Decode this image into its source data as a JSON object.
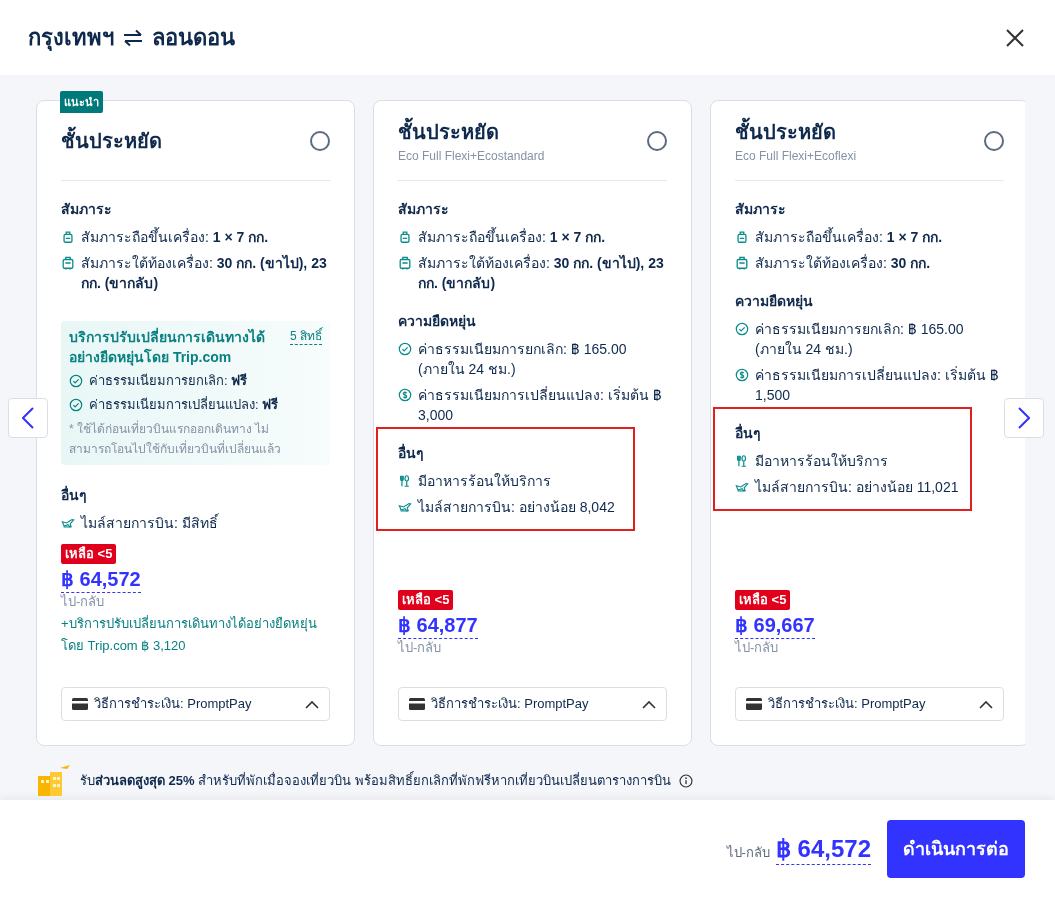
{
  "header": {
    "origin": "กรุงเทพฯ",
    "destination": "ลอนดอน"
  },
  "cards": [
    {
      "badge": "แนะนำ",
      "title": "ชั้นประหยัด",
      "selected": false,
      "sections": [
        {
          "heading": "สัมภาระ",
          "highlighted": false,
          "items": [
            {
              "kind": "carry-on",
              "text": "สัมภาระถือขึ้นเครื่อง: **1 × 7 กก.**"
            },
            {
              "kind": "checked-bag",
              "text": "สัมภาระใต้ท้องเครื่อง: **30 กก. (ขาไป), 23 กก. (ขากลับ)**"
            }
          ]
        }
      ],
      "flexi": {
        "title": "บริการปรับเปลี่ยนการเดินทางได้อย่างยืดหยุ่นโดย Trip.com",
        "link": "5 สิทธิ์",
        "items": [
          {
            "kind": "check",
            "text": "ค่าธรรมเนียมการยกเลิก: **ฟรี**"
          },
          {
            "kind": "check",
            "text": "ค่าธรรมเนียมการเปลี่ยนแปลง: **ฟรี**"
          }
        ],
        "note": "* ใช้ได้ก่อนเที่ยวบินแรกออกเดินทาง ไม่สามารถโอนไปใช้กับเที่ยวบินที่เปลี่ยนแล้ว"
      },
      "sections2": [
        {
          "heading": "อื่นๆ",
          "highlighted": false,
          "items": [
            {
              "kind": "miles",
              "text": "ไมล์สายการบิน: มีสิทธิ์"
            }
          ]
        }
      ],
      "availability": "เหลือ <5",
      "price": "฿ 64,572",
      "price_note": "ไป-กลับ",
      "addon": "+บริการปรับเปลี่ยนการเดินทางได้อย่างยืดหยุ่นโดย Trip.com ฿ 3,120",
      "payment": "วิธีการชำระเงิน: PromptPay"
    },
    {
      "title": "ชั้นประหยัด",
      "subtitle": "Eco Full Flexi+Ecostandard",
      "selected": false,
      "sections": [
        {
          "heading": "สัมภาระ",
          "highlighted": false,
          "items": [
            {
              "kind": "carry-on",
              "text": "สัมภาระถือขึ้นเครื่อง: **1 × 7 กก.**"
            },
            {
              "kind": "checked-bag",
              "text": "สัมภาระใต้ท้องเครื่อง: **30 กก. (ขาไป), 23 กก. (ขากลับ)**"
            }
          ]
        },
        {
          "heading": "ความยืดหยุ่น",
          "highlighted": false,
          "items": [
            {
              "kind": "check",
              "text": "ค่าธรรมเนียมการยกเลิก: ฿ 165.00 (ภายใน 24 ชม.)"
            },
            {
              "kind": "dollar",
              "text": "ค่าธรรมเนียมการเปลี่ยนแปลง: เริ่มต้น ฿ 3,000"
            }
          ]
        },
        {
          "heading": "อื่นๆ",
          "highlighted": true,
          "items": [
            {
              "kind": "meal",
              "text": "มีอาหารร้อนให้บริการ"
            },
            {
              "kind": "miles",
              "text": "ไมล์สายการบิน: อย่างน้อย 8,042"
            }
          ]
        }
      ],
      "availability": "เหลือ <5",
      "price": "฿ 64,877",
      "price_note": "ไป-กลับ",
      "payment": "วิธีการชำระเงิน: PromptPay"
    },
    {
      "title": "ชั้นประหยัด",
      "subtitle": "Eco Full Flexi+Ecoflexi",
      "selected": false,
      "sections": [
        {
          "heading": "สัมภาระ",
          "highlighted": false,
          "items": [
            {
              "kind": "carry-on",
              "text": "สัมภาระถือขึ้นเครื่อง: **1 × 7 กก.**"
            },
            {
              "kind": "checked-bag",
              "text": "สัมภาระใต้ท้องเครื่อง: **30 กก.**"
            }
          ]
        },
        {
          "heading": "ความยืดหยุ่น",
          "highlighted": false,
          "items": [
            {
              "kind": "check",
              "text": "ค่าธรรมเนียมการยกเลิก: ฿ 165.00 (ภายใน 24 ชม.)"
            },
            {
              "kind": "dollar",
              "text": "ค่าธรรมเนียมการเปลี่ยนแปลง: เริ่มต้น ฿ 1,500"
            }
          ]
        },
        {
          "heading": "อื่นๆ",
          "highlighted": true,
          "items": [
            {
              "kind": "meal",
              "text": "มีอาหารร้อนให้บริการ"
            },
            {
              "kind": "miles",
              "text": "ไมล์สายการบิน: อย่างน้อย 11,021"
            }
          ]
        }
      ],
      "availability": "เหลือ <5",
      "price": "฿ 69,667",
      "price_note": "ไป-กลับ",
      "payment": "วิธีการชำระเงิน: PromptPay"
    }
  ],
  "promo": "รับ**ส่วนลดสูงสุด 25%** สำหรับที่พักเมื่อจองเที่ยวบิน พร้อมสิทธิ์ยกเลิกที่พักฟรีหากเที่ยวบินเปลี่ยนตารางการบิน",
  "footer": {
    "price_note": "ไป-กลับ",
    "price": "฿ 64,572",
    "button": "ดำเนินการต่อ"
  }
}
